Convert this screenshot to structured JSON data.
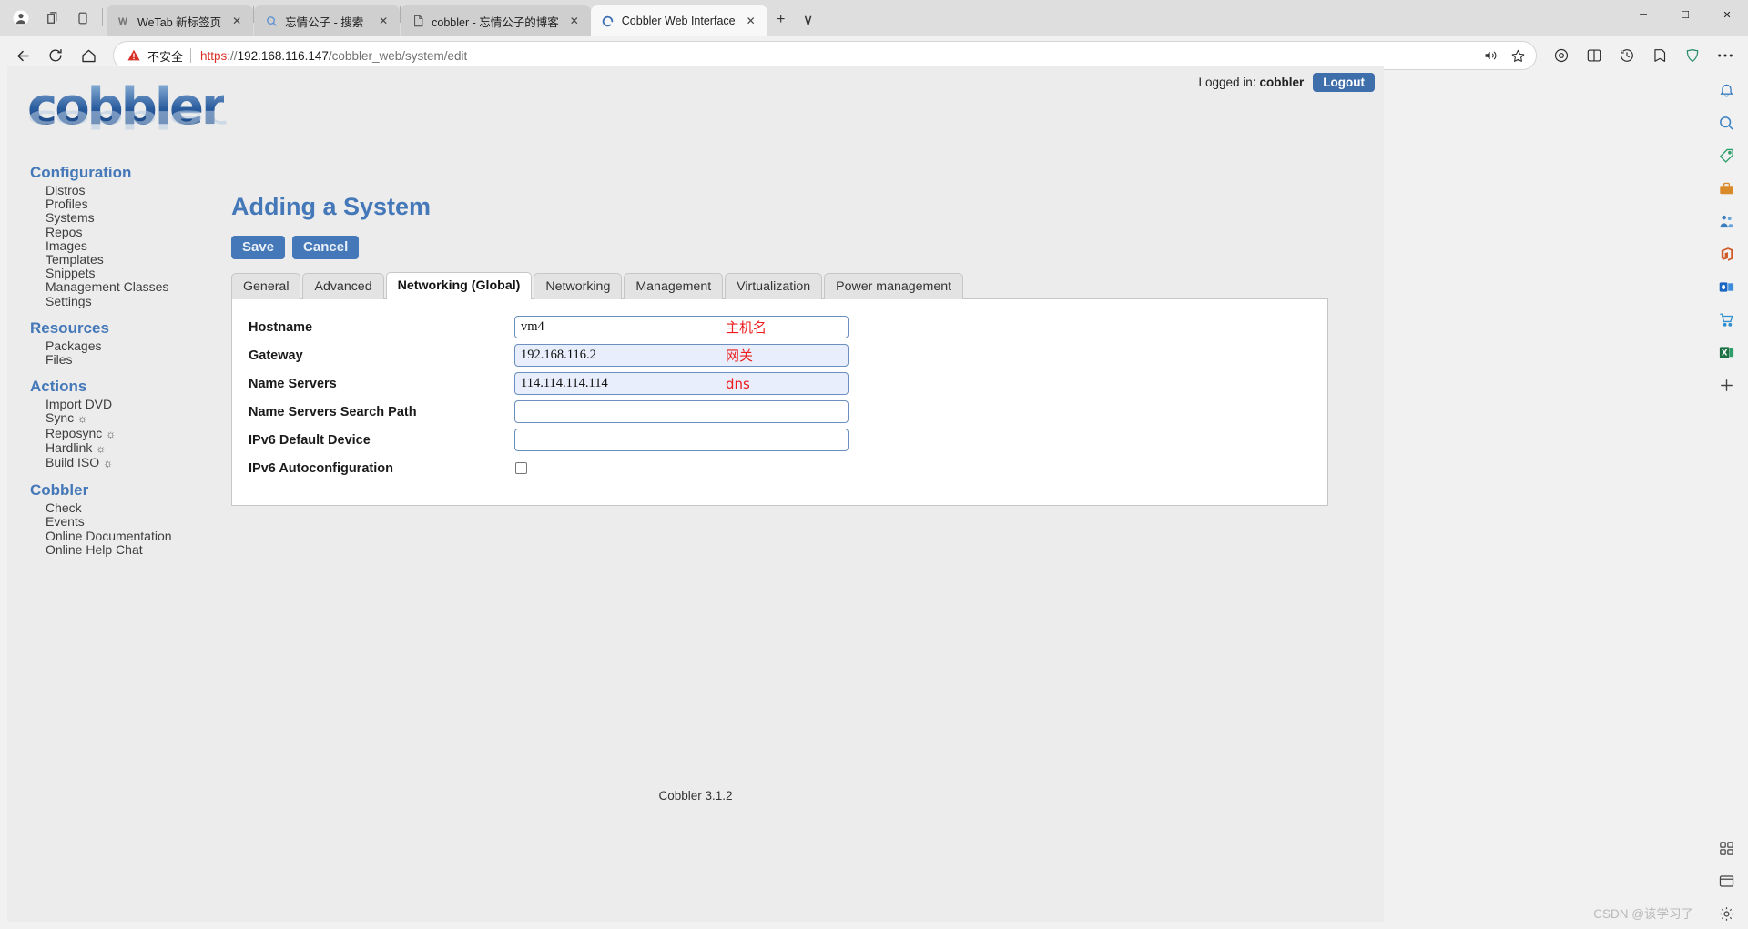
{
  "browser": {
    "tabs": [
      {
        "title": "WeTab 新标签页",
        "icon": "wetab-icon",
        "active": false
      },
      {
        "title": "忘情公子 - 搜索",
        "icon": "search-icon",
        "active": false
      },
      {
        "title": "cobbler - 忘情公子的博客",
        "icon": "page-icon",
        "active": false
      },
      {
        "title": "Cobbler Web Interface",
        "icon": "loading-spinner-icon",
        "active": true
      }
    ],
    "new_tab_label": "+",
    "tab_menu_label": "∨",
    "window_controls": {
      "minimize": "─",
      "maximize": "☐",
      "close": "✕"
    },
    "address": {
      "security_label": "不安全",
      "scheme": "https",
      "separator": "://",
      "host": "192.168.116.147",
      "path": "/cobbler_web/system/edit",
      "read_aloud_icon": "read-aloud-icon",
      "favorite_icon": "star-icon"
    },
    "toolbar_icons": [
      "back-icon",
      "refresh-icon",
      "home-icon",
      "collections-icon",
      "split-screen-icon",
      "history-icon",
      "favorites-icon",
      "browser-essentials-icon",
      "settings-more-icon"
    ]
  },
  "page": {
    "login": {
      "prefix": "Logged in:",
      "user": "cobbler",
      "logout": "Logout"
    },
    "logo_text": "cobbler",
    "sidebar": [
      {
        "heading": "Configuration",
        "items": [
          {
            "label": "Distros"
          },
          {
            "label": "Profiles"
          },
          {
            "label": "Systems"
          },
          {
            "label": "Repos"
          },
          {
            "label": "Images"
          },
          {
            "label": "Templates"
          },
          {
            "label": "Snippets"
          },
          {
            "label": "Management Classes"
          },
          {
            "label": "Settings"
          }
        ]
      },
      {
        "heading": "Resources",
        "items": [
          {
            "label": "Packages"
          },
          {
            "label": "Files"
          }
        ]
      },
      {
        "heading": "Actions",
        "items": [
          {
            "label": "Import DVD"
          },
          {
            "label": "Sync",
            "gear": "☼"
          },
          {
            "label": "Reposync",
            "gear": "☼"
          },
          {
            "label": "Hardlink",
            "gear": "☼"
          },
          {
            "label": "Build ISO",
            "gear": "☼"
          }
        ]
      },
      {
        "heading": "Cobbler",
        "items": [
          {
            "label": "Check"
          },
          {
            "label": "Events"
          },
          {
            "label": "Online Documentation"
          },
          {
            "label": "Online Help Chat"
          }
        ]
      }
    ],
    "title": "Adding a System",
    "buttons": {
      "save": "Save",
      "cancel": "Cancel"
    },
    "tabs": [
      {
        "label": "General",
        "active": false
      },
      {
        "label": "Advanced",
        "active": false
      },
      {
        "label": "Networking (Global)",
        "active": true
      },
      {
        "label": "Networking",
        "active": false
      },
      {
        "label": "Management",
        "active": false
      },
      {
        "label": "Virtualization",
        "active": false
      },
      {
        "label": "Power management",
        "active": false
      }
    ],
    "form": [
      {
        "label": "Hostname",
        "value": "vm4",
        "type": "text",
        "autofill": false,
        "annotation": "主机名"
      },
      {
        "label": "Gateway",
        "value": "192.168.116.2",
        "type": "text",
        "autofill": true,
        "annotation": "网关"
      },
      {
        "label": "Name Servers",
        "value": "114.114.114.114",
        "type": "text",
        "autofill": true,
        "annotation": "dns"
      },
      {
        "label": "Name Servers Search Path",
        "value": "",
        "type": "text",
        "autofill": false,
        "annotation": ""
      },
      {
        "label": "IPv6 Default Device",
        "value": "",
        "type": "text",
        "autofill": false,
        "annotation": ""
      },
      {
        "label": "IPv6 Autoconfiguration",
        "value": "",
        "type": "checkbox",
        "checked": false,
        "annotation": ""
      }
    ],
    "footer": "Cobbler 3.1.2"
  },
  "edge_sidebar": {
    "icons": [
      {
        "name": "notifications-bell-icon",
        "glyph": "🔔",
        "color": "#3a7ebf"
      },
      {
        "name": "search-icon",
        "glyph": "🔍",
        "color": "#3b82c4"
      },
      {
        "name": "shopping-tag-icon",
        "glyph": "🏷",
        "color": "#2e9e6b"
      },
      {
        "name": "toolbox-icon",
        "glyph": "🧰",
        "color": "#d98a2b"
      },
      {
        "name": "games-icon",
        "glyph": "👮",
        "color": "#3a7ebf"
      },
      {
        "name": "office-icon",
        "glyph": "⬤",
        "color": "#d15b2b"
      },
      {
        "name": "outlook-icon",
        "glyph": "O",
        "color": "#1a66c2"
      },
      {
        "name": "shopping-cart-icon",
        "glyph": "🛒",
        "color": "#2f8fd0"
      },
      {
        "name": "excel-icon",
        "glyph": "X",
        "color": "#1d7044"
      },
      {
        "name": "add-app-icon",
        "glyph": "＋",
        "color": "#444444"
      }
    ],
    "bottom_icons": [
      {
        "name": "customize-sidebar-icon",
        "glyph": "⌘",
        "color": "#444444"
      },
      {
        "name": "browser-window-icon",
        "glyph": "▭",
        "color": "#444444"
      },
      {
        "name": "sidebar-settings-icon",
        "glyph": "⚙",
        "color": "#444444"
      }
    ]
  },
  "watermark": "CSDN @该学习了"
}
